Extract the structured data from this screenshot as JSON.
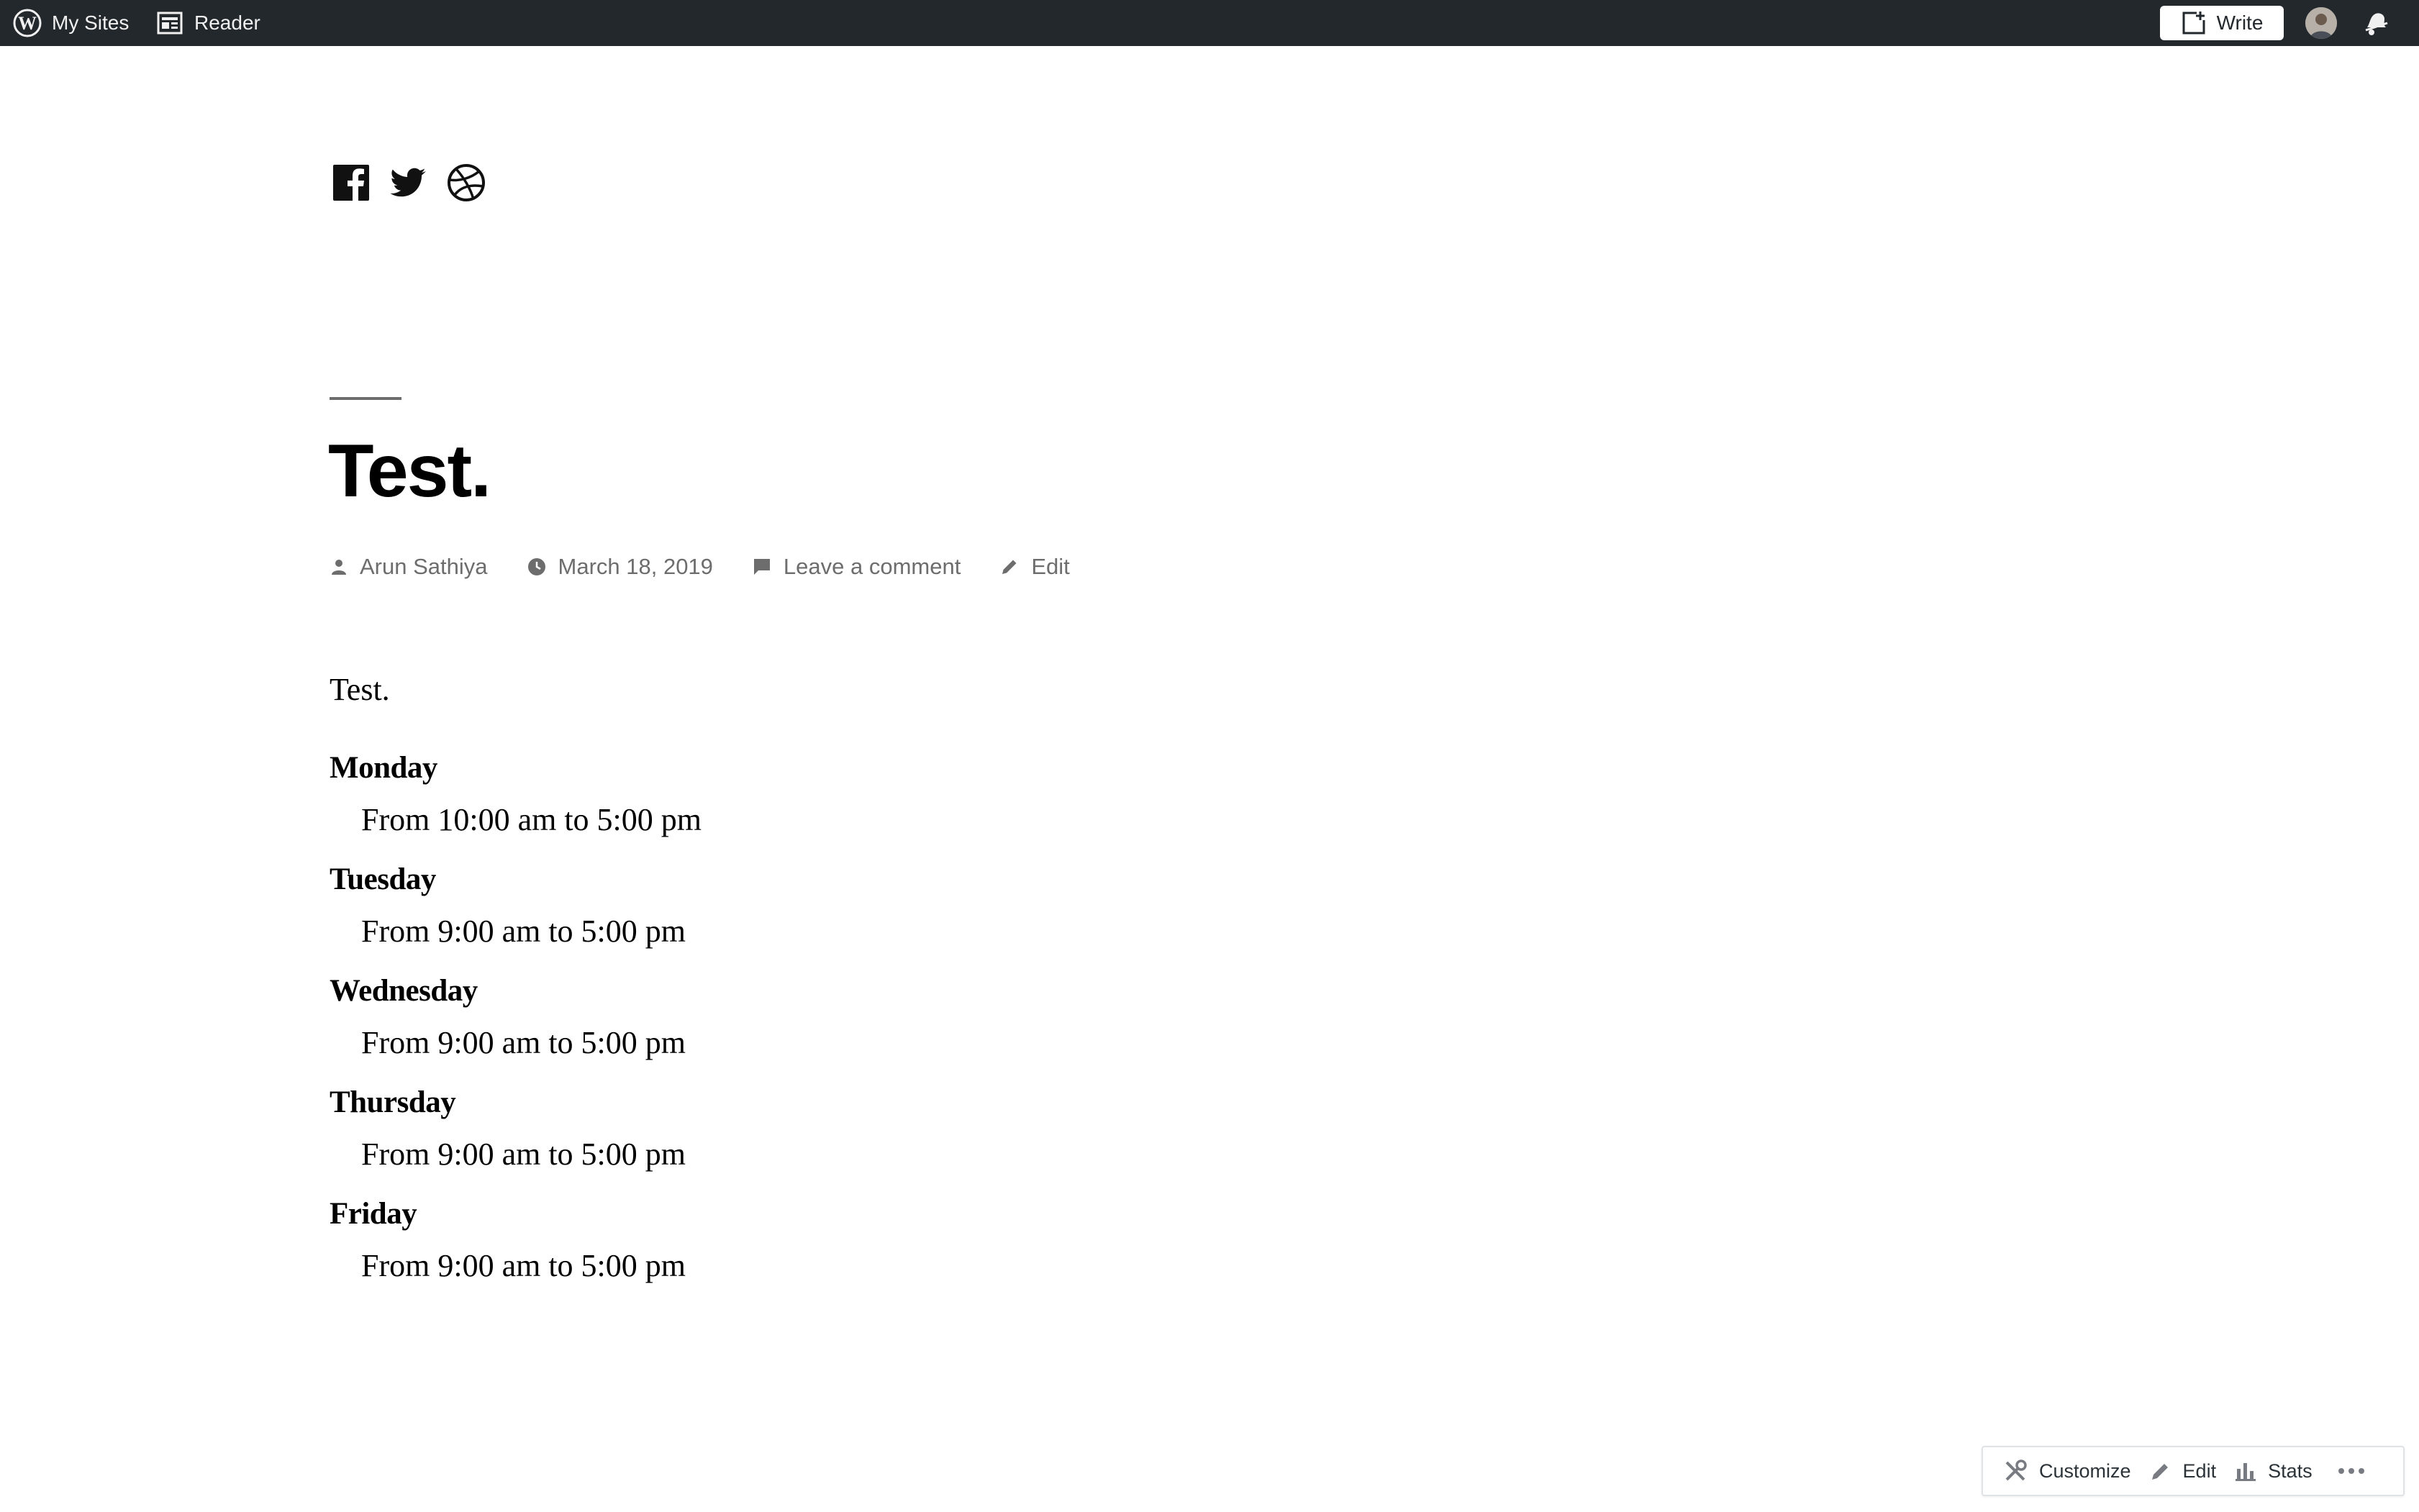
{
  "adminbar": {
    "my_sites": "My Sites",
    "reader": "Reader",
    "write": "Write",
    "colors": {
      "background": "#23282d",
      "text": "#f0f0f0"
    },
    "icons": [
      "wordpress-logo-icon",
      "reader-icon",
      "write-plus-icon",
      "avatar",
      "notifications-bell-icon"
    ]
  },
  "social": {
    "icons": [
      "facebook-icon",
      "twitter-icon",
      "dribbble-icon"
    ]
  },
  "post": {
    "title": "Test.",
    "meta": {
      "author": "Arun Sathiya",
      "date": "March 18, 2019",
      "comments": "Leave a comment",
      "edit": "Edit"
    },
    "intro": "Test.",
    "hours": [
      {
        "day": "Monday",
        "time": "From 10:00 am to 5:00 pm"
      },
      {
        "day": "Tuesday",
        "time": "From 9:00 am to 5:00 pm"
      },
      {
        "day": "Wednesday",
        "time": "From 9:00 am to 5:00 pm"
      },
      {
        "day": "Thursday",
        "time": "From 9:00 am to 5:00 pm"
      },
      {
        "day": "Friday",
        "time": "From 9:00 am to 5:00 pm"
      }
    ]
  },
  "actionbar": {
    "customize": "Customize",
    "edit": "Edit",
    "stats": "Stats"
  }
}
